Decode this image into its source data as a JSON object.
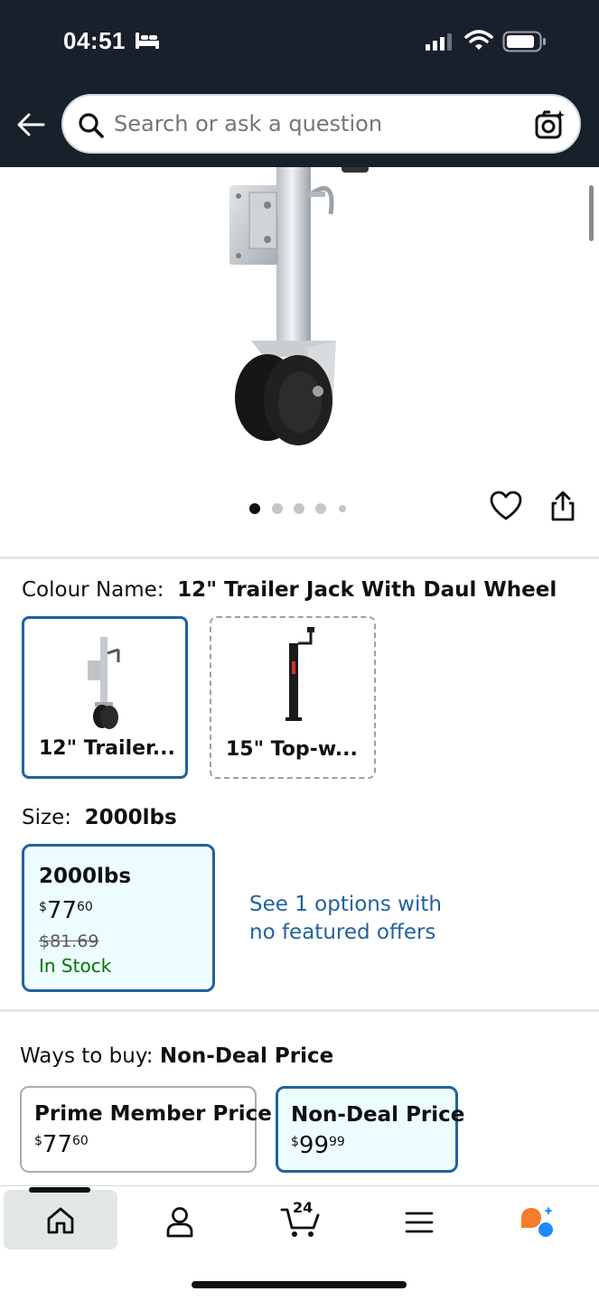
{
  "status_bar": {
    "time": "04:51"
  },
  "search": {
    "placeholder": "Search or ask a question"
  },
  "gallery": {
    "image_count": 5,
    "active_index": 0
  },
  "colour": {
    "label": "Colour Name:",
    "selected_value": "12\" Trailer Jack With Daul Wheel",
    "options": [
      {
        "label": "12\" Trailer..."
      },
      {
        "label": "15\" Top-w..."
      }
    ]
  },
  "size": {
    "label": "Size:",
    "selected_value": "2000lbs",
    "option": {
      "name": "2000lbs",
      "price_currency": "$",
      "price_whole": "77",
      "price_fraction": "60",
      "was_price": "$81.69",
      "stock": "In Stock"
    },
    "see_options_link": "See 1 options with no featured offers"
  },
  "ways_to_buy": {
    "label": "Ways to buy:",
    "selected_value": "Non-Deal Price",
    "options": [
      {
        "title": "Prime Member Price",
        "currency": "$",
        "whole": "77",
        "fraction": "60"
      },
      {
        "title": "Non-Deal Price",
        "currency": "$",
        "whole": "99",
        "fraction": "99"
      }
    ]
  },
  "bottom_nav": {
    "cart_count": "24",
    "items": [
      "home-icon",
      "account-icon",
      "cart-icon",
      "menu-icon",
      "assistant-icon"
    ]
  },
  "colors": {
    "header_bg": "#18202b",
    "link_blue": "#2162a1",
    "selected_bg": "#edfdff",
    "in_stock_green": "#007600",
    "assistant_orange": "#f57c2c",
    "assistant_blue": "#1a8cff"
  }
}
